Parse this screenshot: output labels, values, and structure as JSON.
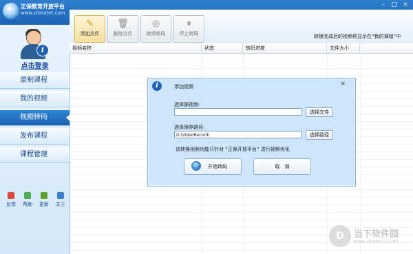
{
  "app": {
    "title": "正保教育开放平台",
    "subtitle": "www.chinatet.com"
  },
  "window": {
    "min": "–",
    "max": "□",
    "close": "×"
  },
  "sidebar": {
    "login": "点击登录",
    "items": [
      {
        "label": "录制课程",
        "active": false
      },
      {
        "label": "我的视频",
        "active": false
      },
      {
        "label": "视频转码",
        "active": true
      },
      {
        "label": "发布课程",
        "active": false
      },
      {
        "label": "课程管理",
        "active": false
      }
    ],
    "tools": [
      {
        "label": "反馈",
        "icon": "feedback-icon",
        "color": "#d94a3a"
      },
      {
        "label": "帮助",
        "icon": "help-icon",
        "color": "#4caf50"
      },
      {
        "label": "更新",
        "icon": "update-icon",
        "color": "#59a32c"
      },
      {
        "label": "关于",
        "icon": "about-icon",
        "color": "#3b7fd0"
      }
    ]
  },
  "toolbar": {
    "buttons": [
      {
        "label": "添加文件",
        "icon": "✎",
        "active": true
      },
      {
        "label": "删除文件",
        "icon": "🗑",
        "active": false
      },
      {
        "label": "继续转码",
        "icon": "◎",
        "active": false
      },
      {
        "label": "停止转码",
        "icon": "⏸",
        "active": false
      }
    ],
    "hint": "转换完成后的视频将显示在“我的课程”中"
  },
  "table": {
    "columns": [
      "视频名称",
      "状态",
      "转码进度",
      "文件大小"
    ]
  },
  "dialog": {
    "title": "添加视频",
    "close": "×",
    "source_label": "选择源视频:",
    "source_value": "",
    "source_button": "选择文件",
    "save_label": "选择保存路径:",
    "save_value": "D:\\VideoRecord\\",
    "save_button": "选择路径",
    "note": "该转换视频功能只针对 “正保开放平台” 进行视频优化",
    "start_button": "开始转码",
    "cancel_button": "取　消"
  },
  "watermark": {
    "name": "当下软件园",
    "url": "www.downxia.com",
    "logo": "D"
  }
}
